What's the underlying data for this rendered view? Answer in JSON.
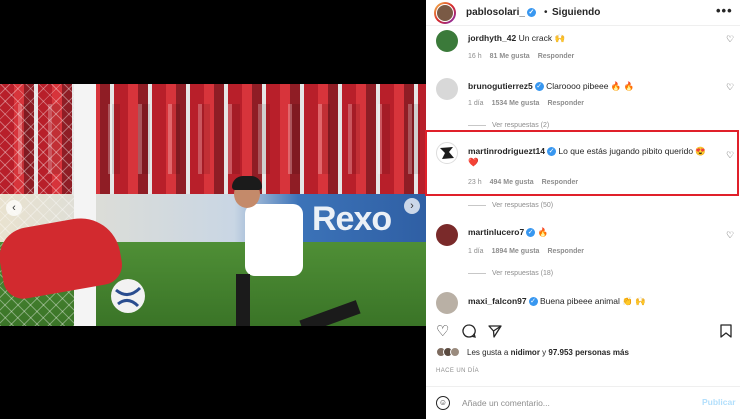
{
  "header": {
    "username": "pablosolari_",
    "separator": "•",
    "follow_status": "Siguiendo",
    "more": "•••"
  },
  "comments": [
    {
      "username": "jordhyth_42",
      "verified": false,
      "text": "Un crack 🙌",
      "time": "16 h",
      "likes": "81 Me gusta",
      "reply": "Responder",
      "replies": null
    },
    {
      "username": "brunogutierrez5",
      "verified": true,
      "text": "Claroooo pibeee 🔥 🔥",
      "time": "1 día",
      "likes": "1534 Me gusta",
      "reply": "Responder",
      "replies": "Ver respuestas (2)"
    },
    {
      "username": "martinrodriguezt14",
      "verified": true,
      "text": "Lo que estás jugando pibito querido 😍 ❤️",
      "time": "23 h",
      "likes": "494 Me gusta",
      "reply": "Responder",
      "replies": "Ver respuestas (50)"
    },
    {
      "username": "martinlucero7",
      "verified": true,
      "text": "🔥",
      "time": "1 día",
      "likes": "1894 Me gusta",
      "reply": "Responder",
      "replies": "Ver respuestas (18)"
    },
    {
      "username": "maxi_falcon97",
      "verified": true,
      "text": "Buena pibeee animal 👏 🙌",
      "time": "",
      "likes": "",
      "reply": "",
      "replies": null
    }
  ],
  "likes_summary": {
    "prefix": "Les gusta a ",
    "user": "nidimor",
    "middle": " y ",
    "count": "97.953 personas más"
  },
  "posted_ago": "HACE UN DÍA",
  "comment_box": {
    "placeholder": "Añade un comentario...",
    "post_label": "Publicar"
  },
  "media": {
    "ad_text": "Rexo",
    "carousel_dots": 6,
    "active_dot": 0
  },
  "icons": {
    "like": "heart-icon",
    "comment": "comment-icon",
    "share": "share-icon",
    "save": "bookmark-icon",
    "emoji": "emoji-icon"
  },
  "colors": {
    "highlight": "#e0202a",
    "verified": "#3897f0",
    "post_button": "#b2dffc"
  }
}
